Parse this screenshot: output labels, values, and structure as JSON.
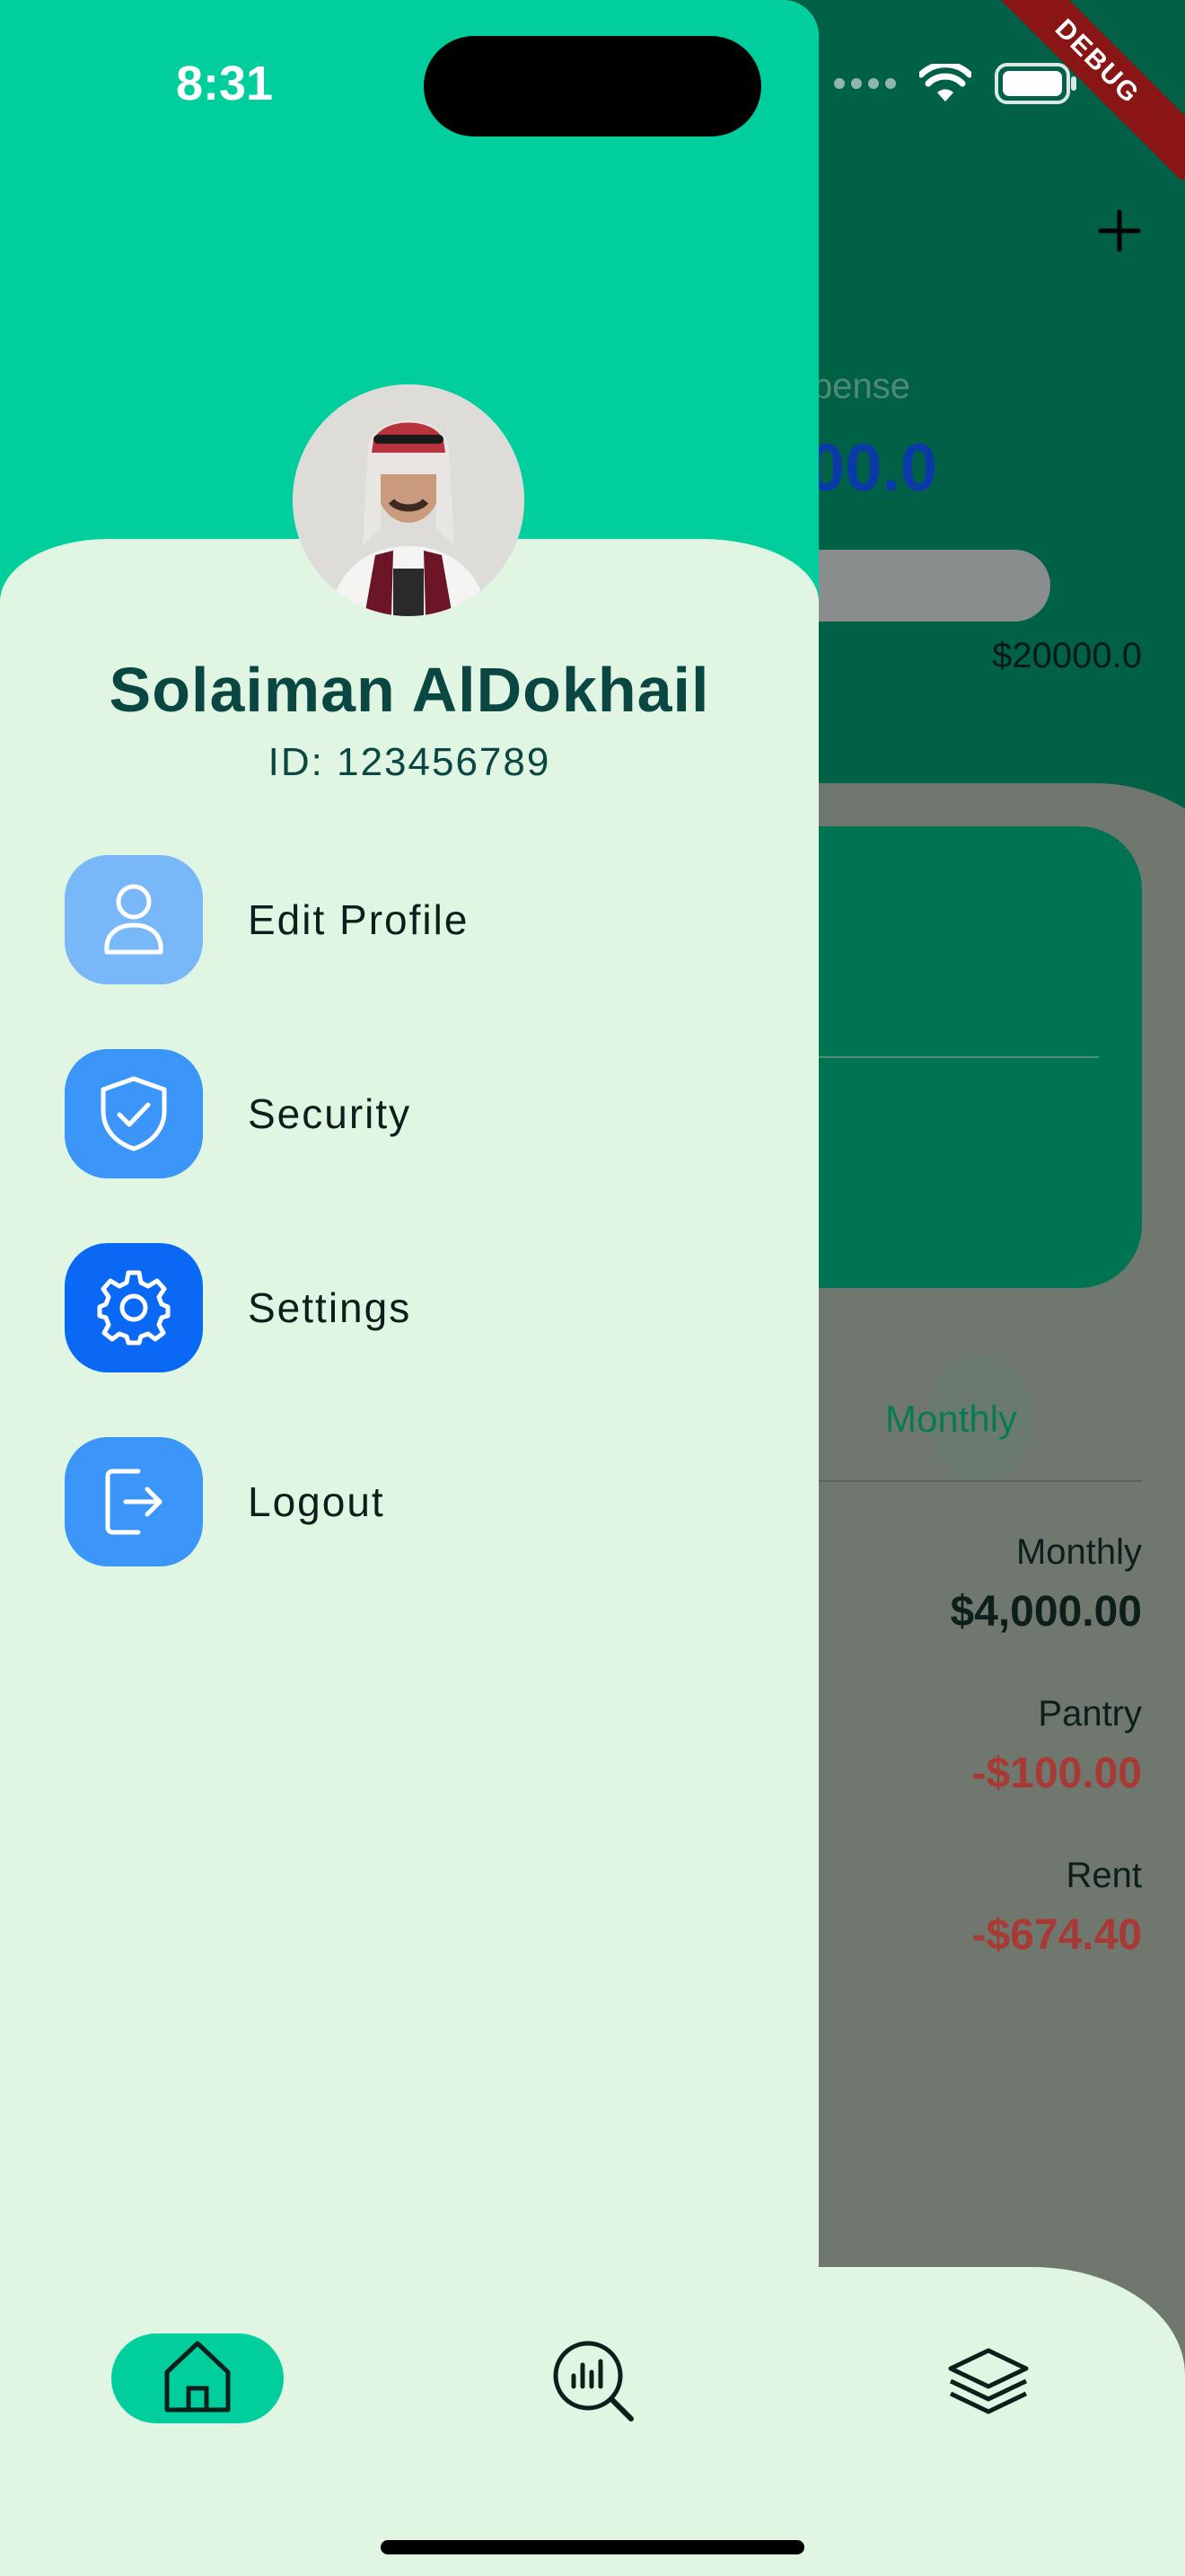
{
  "status_bar": {
    "time": "8:31"
  },
  "background": {
    "expense_label": "pense",
    "expense_value": "00.0",
    "limit_value": "$20000.0",
    "tab_label": "Monthly",
    "transactions": [
      {
        "label": "Monthly",
        "amount": "$4,000.00",
        "color": "#0c1f1b"
      },
      {
        "label": "Pantry",
        "amount": "-$100.00",
        "color": "#a83a35"
      },
      {
        "label": "Rent",
        "amount": "-$674.40",
        "color": "#a83a35"
      }
    ]
  },
  "debug_banner": "DEBUG",
  "drawer": {
    "user_name": "Solaiman AlDokhail",
    "user_id": "ID: 123456789",
    "menu": [
      {
        "label": "Edit Profile",
        "icon": "person-icon",
        "color": "#78b8f8"
      },
      {
        "label": "Security",
        "icon": "shield-check-icon",
        "color": "#3c96fa"
      },
      {
        "label": "Settings",
        "icon": "gear-icon",
        "color": "#0968f4"
      },
      {
        "label": "Logout",
        "icon": "logout-icon",
        "color": "#3c96fa"
      }
    ]
  },
  "bottom_nav": {
    "items": [
      {
        "icon": "home-icon",
        "active": true
      },
      {
        "icon": "analysis-icon",
        "active": false
      },
      {
        "icon": "layers-icon",
        "active": false
      }
    ],
    "active_color": "#00cf9d"
  },
  "colors": {
    "primary_green": "#00cf9d",
    "drawer_bg": "#e0f6e3",
    "text_dark": "#0a4743"
  }
}
